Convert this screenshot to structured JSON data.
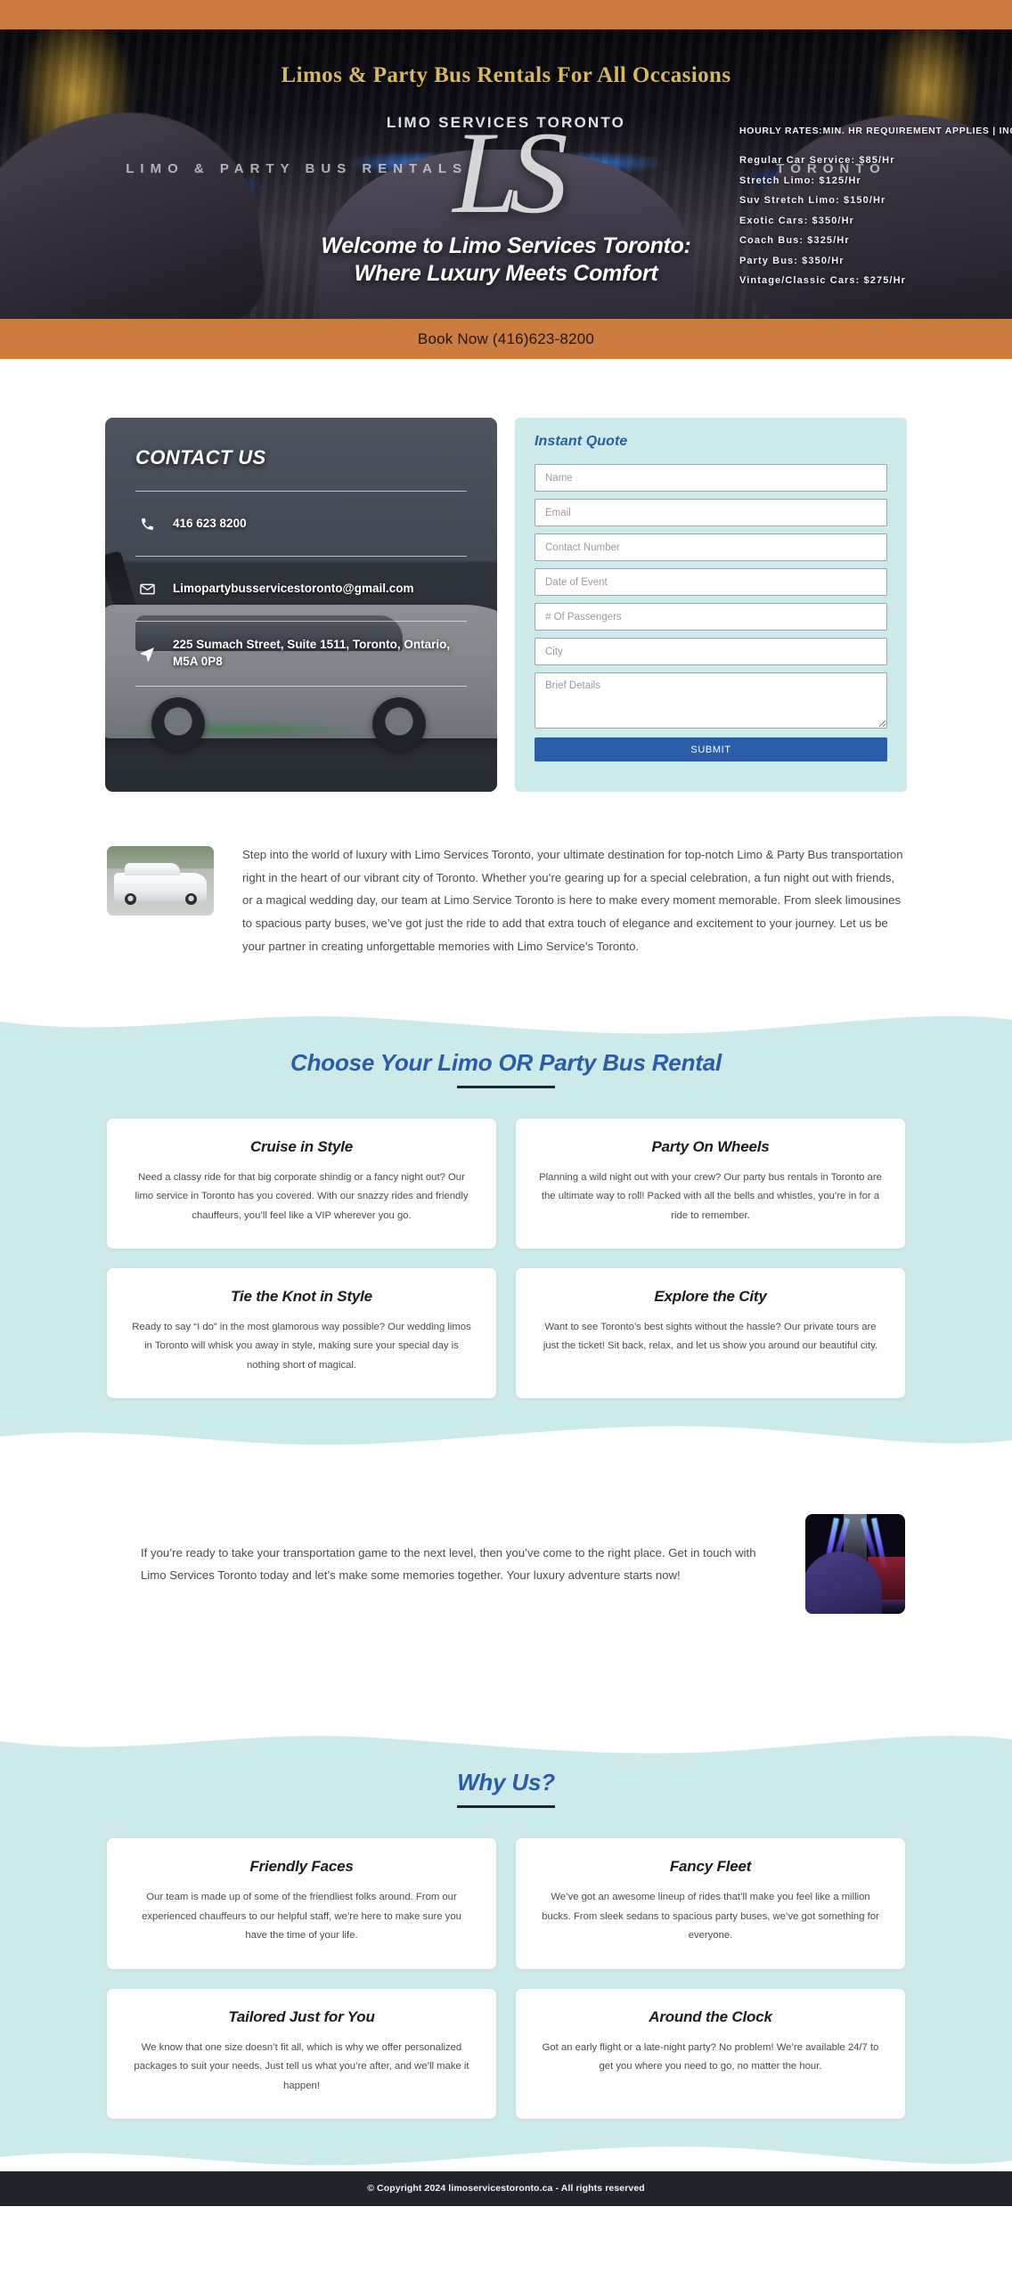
{
  "hero": {
    "tagline": "Limos & Party Bus Rentals For All Occasions",
    "brand_small": "LIMO SERVICES TORONTO",
    "logo_mark": "LS",
    "subbrand_left": "LIMO & PARTY BUS RENTALS",
    "subbrand_right": "TORONTO",
    "welcome_line1": "Welcome to Limo Services Toronto:",
    "welcome_line2": "Where Luxury Meets Comfort",
    "rates_heading": "HOURLY RATES:MIN. HR REQUIREMENT APPLIES | INQUIRE",
    "rates": [
      "Regular Car Service: $85/Hr",
      "Stretch Limo: $125/Hr",
      "Suv Stretch Limo: $150/Hr",
      "Exotic Cars: $350/Hr",
      "Coach Bus: $325/Hr",
      "Party Bus: $350/Hr",
      "Vintage/Classic Cars: $275/Hr"
    ]
  },
  "booknow": {
    "label": "Book Now (416)623-8200"
  },
  "contact": {
    "title": "CONTACT US",
    "phone": "416 623 8200",
    "email": "Limopartybusservicestoronto@gmail.com",
    "address": "225 Sumach Street, Suite 1511, Toronto, Ontario, M5A 0P8"
  },
  "quote": {
    "title": "Instant Quote",
    "fields": [
      {
        "name": "name",
        "placeholder": "Name",
        "value": ""
      },
      {
        "name": "email",
        "placeholder": "Email",
        "value": ""
      },
      {
        "name": "contact-number",
        "placeholder": "Contact Number",
        "value": ""
      },
      {
        "name": "date-of-event",
        "placeholder": "Date of Event",
        "value": ""
      },
      {
        "name": "passengers",
        "placeholder": "# Of Passengers",
        "value": ""
      },
      {
        "name": "city",
        "placeholder": "City",
        "value": ""
      }
    ],
    "details_placeholder": "Brief Details",
    "submit_label": "SUBMIT"
  },
  "intro": {
    "paragraph": "Step into the world of luxury with Limo Services Toronto, your ultimate destination for top-notch Limo & Party Bus transportation right in the heart of our vibrant city of Toronto. Whether you’re gearing up for a special celebration, a fun night out with friends, or a magical wedding day, our team at Limo Service Toronto is here to make every moment memorable. From sleek limousines to spacious party buses, we’ve got just the ride to add that extra touch of elegance and excitement to your journey. Let us be your partner in creating unforgettable memories with Limo Service’s Toronto."
  },
  "choose": {
    "title": "Choose Your Limo OR Party Bus Rental",
    "cards": [
      {
        "title": "Cruise in Style",
        "body": "Need a classy ride for that big corporate shindig or a fancy night out? Our limo service in Toronto has you covered. With our snazzy rides and friendly chauffeurs, you’ll feel like a VIP wherever you go."
      },
      {
        "title": "Party On Wheels",
        "body": "Planning a wild night out with your crew? Our party bus rentals in Toronto are the ultimate way to roll! Packed with all the bells and whistles, you’re in for a ride to remember."
      },
      {
        "title": "Tie the Knot in Style",
        "body": "Ready to say “I do” in the most glamorous way possible? Our wedding limos in Toronto will whisk you away in style, making sure your special day is nothing short of magical."
      },
      {
        "title": "Explore the City",
        "body": "Want to see Toronto’s best sights without the hassle? Our private tours are just the ticket! Sit back, relax, and let us show you around our beautiful city."
      }
    ]
  },
  "cta": {
    "paragraph": "If you’re ready to take your transportation game to the next level, then you’ve come to the right place. Get in touch with Limo Services Toronto today and let’s make some memories together. Your luxury adventure starts now!"
  },
  "why": {
    "title": "Why Us?",
    "cards": [
      {
        "title": "Friendly Faces",
        "body": "Our team is made up of some of the friendliest folks around. From our experienced chauffeurs to our helpful staff, we’re here to make sure you have the time of your life."
      },
      {
        "title": "Fancy Fleet",
        "body": "We’ve got an awesome lineup of rides that’ll make you feel like a million bucks. From sleek sedans to spacious party buses, we’ve got something for everyone."
      },
      {
        "title": "Tailored Just for You",
        "body": "We know that one size doesn’t fit all, which is why we offer personalized packages to suit your needs. Just tell us what you’re after, and we’ll make it happen!"
      },
      {
        "title": "Around the Clock",
        "body": "Got an early flight or a late-night party? No problem! We’re available 24/7 to get you where you need to go, no matter the hour."
      }
    ]
  },
  "footer": {
    "copyright": "© Copyright 2024 limoservicestoronto.ca - All rights reserved"
  },
  "colors": {
    "accent_orange": "#cb7c3e",
    "teal": "#cdeaea",
    "blue": "#2a5ca8",
    "footer_dark": "#22262c"
  }
}
